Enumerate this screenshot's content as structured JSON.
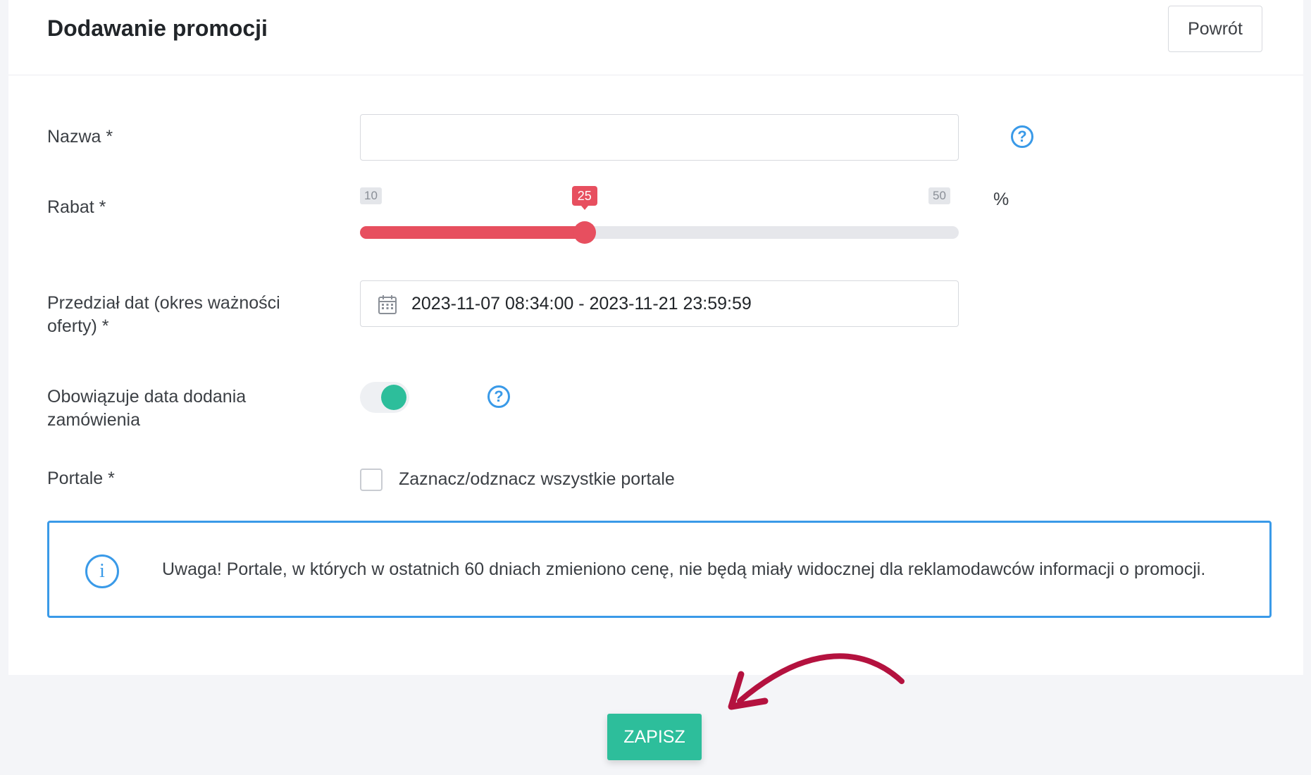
{
  "header": {
    "title": "Dodawanie promocji",
    "back_label": "Powrót"
  },
  "form": {
    "name": {
      "label": "Nazwa *",
      "value": "",
      "placeholder": ""
    },
    "discount": {
      "label": "Rabat *",
      "min": "10",
      "max": "50",
      "value": "25",
      "unit": "%"
    },
    "dates": {
      "label": "Przedział dat (okres ważności oferty) *",
      "value": "2023-11-07 08:34:00 - 2023-11-21 23:59:59"
    },
    "order_date": {
      "label": "Obowiązuje data dodania zamówienia",
      "enabled": true
    },
    "portals": {
      "label": "Portale *",
      "select_all_label": "Zaznacz/odznacz wszystkie portale",
      "checked": false
    }
  },
  "alert": {
    "text": "Uwaga! Portale, w których w ostatnich 60 dniach zmieniono cenę, nie będą miały widocznej dla reklamodawców informacji o promocji."
  },
  "footer": {
    "save_label": "ZAPISZ"
  },
  "colors": {
    "accent_green": "#2dbe9b",
    "slider_red": "#e74f5f",
    "info_blue": "#3a9ae8",
    "arrow": "#b4123f"
  },
  "icons": [
    "help-icon",
    "calendar-icon",
    "info-icon",
    "curved-arrow-icon"
  ]
}
